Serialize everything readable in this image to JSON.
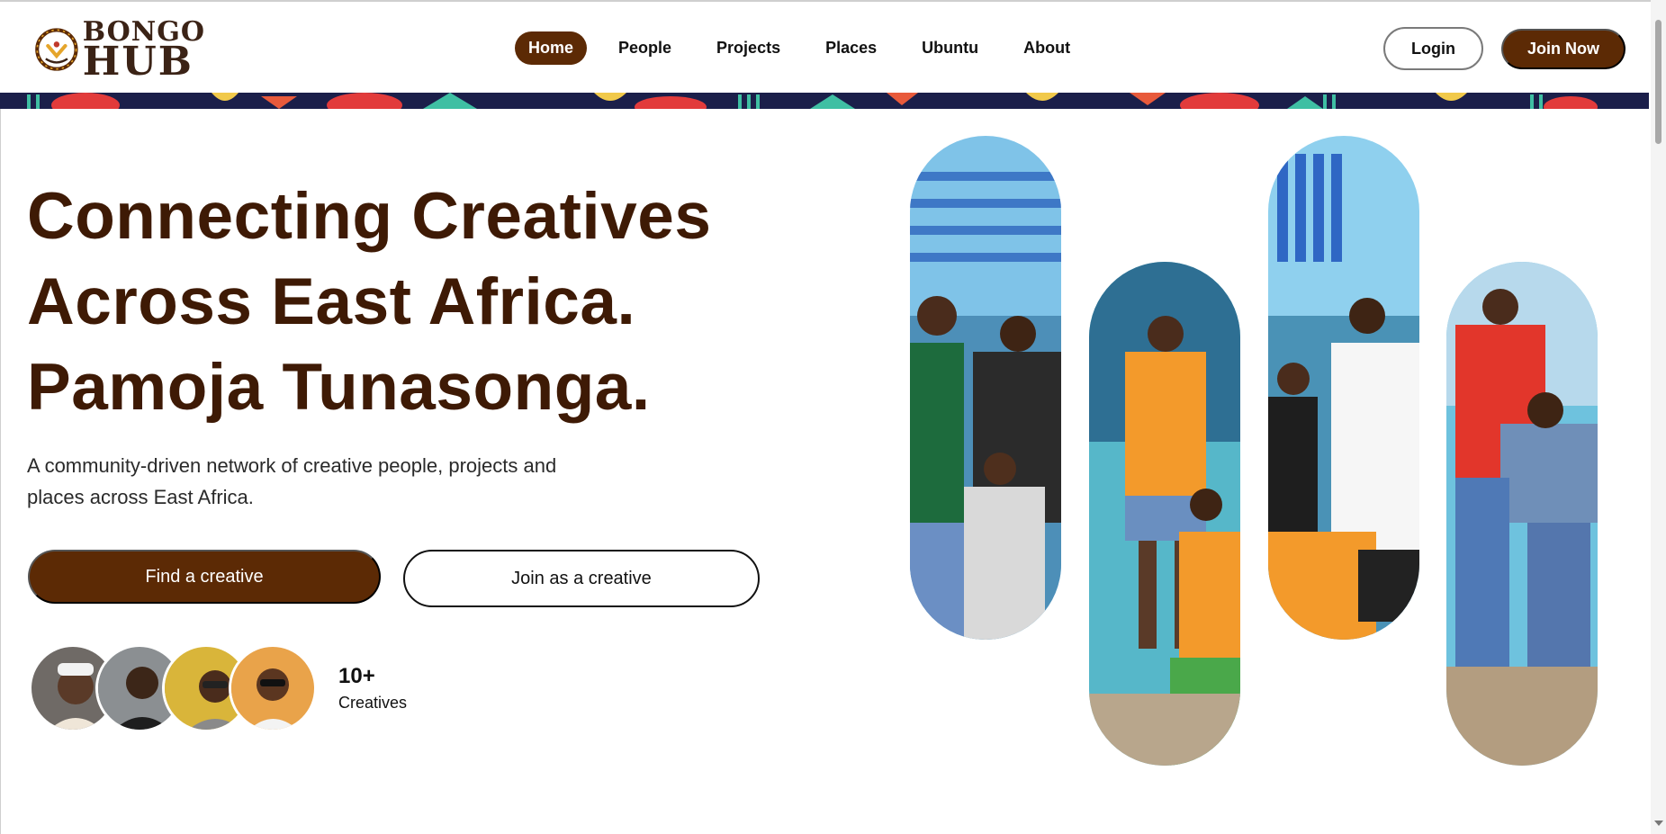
{
  "logo": {
    "line1": "BONGO",
    "line2": "HUB",
    "icon": "bongo-hub-logo-mark"
  },
  "nav": {
    "items": [
      {
        "label": "Home",
        "active": true
      },
      {
        "label": "People",
        "active": false
      },
      {
        "label": "Projects",
        "active": false
      },
      {
        "label": "Places",
        "active": false
      },
      {
        "label": "Ubuntu",
        "active": false
      },
      {
        "label": "About",
        "active": false
      }
    ]
  },
  "auth": {
    "login_label": "Login",
    "join_label": "Join Now"
  },
  "hero": {
    "title_lines": [
      "Connecting Creatives",
      "Across East Africa.",
      "Pamoja Tunasonga."
    ],
    "description": "A community-driven network of creative people, projects and places across East Africa.",
    "primary_cta": "Find a creative",
    "secondary_cta": "Join as a creative"
  },
  "community": {
    "count": "10+",
    "label": "Creatives"
  },
  "colors": {
    "brand": "#5c2a05",
    "title": "#3e1a05",
    "pattern_bg": "#1b1f4a"
  },
  "icons": {
    "scroll_arrow": "chevron-down-icon"
  }
}
